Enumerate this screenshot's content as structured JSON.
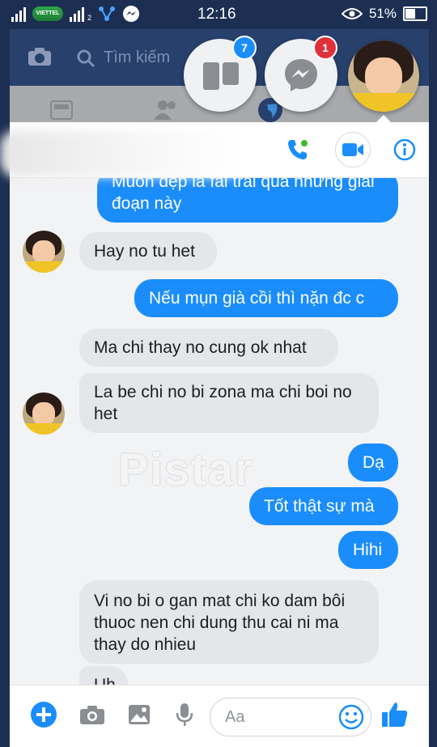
{
  "status_bar": {
    "time": "12:16",
    "battery": "51%",
    "carrier": "VIETTEL",
    "sim": "2"
  },
  "background_app": {
    "search_placeholder": "Tìm kiếm"
  },
  "chat_heads": {
    "pages_count": "7",
    "messenger_count": "1"
  },
  "messages": [
    {
      "text": "Muốn đẹp là fai trải qua những giai đoạn này"
    },
    {
      "text": "Hay no tu het"
    },
    {
      "text": "Nếu mụn già cồi thì nặn đc c"
    },
    {
      "text": "Ma chi thay no cung ok nhat"
    },
    {
      "text": "La be chi no bi zona ma chi boi no het"
    },
    {
      "text": "Dạ"
    },
    {
      "text": "Tốt thật sự mà"
    },
    {
      "text": "Hihi"
    },
    {
      "text": "Vi no bi o gan mat chi ko dam bôi thuoc nen chi dung thu cai ni ma thay do nhieu"
    },
    {
      "text": "Uh"
    }
  ],
  "watermark": "Pistar",
  "composer": {
    "placeholder": "Aa"
  },
  "colors": {
    "accent": "#1a8dfa",
    "status_bg": "#1c2f52",
    "badge": "#e0303a",
    "badge_blue": "#1a8dfa"
  }
}
